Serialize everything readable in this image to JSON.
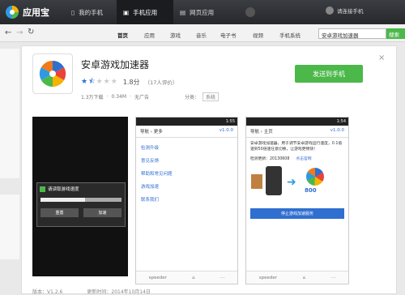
{
  "app": {
    "name": "应用宝",
    "login": "请连接手机",
    "close": "×"
  },
  "tabs": [
    {
      "label": "我的手机"
    },
    {
      "label": "手机应用"
    },
    {
      "label": "网页应用"
    }
  ],
  "nav": [
    "首页",
    "应用",
    "游戏",
    "音乐",
    "电子书",
    "视频",
    "手机系统"
  ],
  "search": {
    "value": "安卓游戏加速器",
    "button": "搜索"
  },
  "detail": {
    "title": "安卓游戏加速器",
    "rating": "1.8分",
    "reviews": "（17人评价）",
    "stars": 1.5,
    "downloads": "1.3万下载",
    "size": "0.34M",
    "ads": "无广告",
    "category_label": "分类：",
    "category": "系统",
    "send_button": "发送到手机",
    "close": "×"
  },
  "screens": {
    "dialog": {
      "title": "请读取游戏速度",
      "btn1": "重置",
      "btn2": "加速"
    },
    "more": {
      "time": "1:55",
      "back": "导航",
      "title": "更多",
      "version": "v1.0.0",
      "items": [
        "检测升级",
        "意见反馈",
        "帮助和常见问题",
        "游戏加速",
        "联系我们"
      ],
      "footer": "speeder"
    },
    "main": {
      "time": "1:54",
      "back": "导航",
      "title": "主页",
      "version": "v1.0.0",
      "desc": "安卓游戏加速器，用于调节安卓游戏运行速度，0.1倍速到50倍速任意切换，让游戏更畅快！",
      "ver_label": "检测更新：20130608",
      "link": "点击官网",
      "badge": "800",
      "button": "停止游戏加速服务",
      "footer": "speeder"
    }
  },
  "footer": {
    "version": "版本：V1.2.6",
    "date": "更新时间：2014年10月14日"
  },
  "colors": {
    "accent": "#4cb84a",
    "topbar": "#2c2e33",
    "link": "#2f6fd0"
  }
}
